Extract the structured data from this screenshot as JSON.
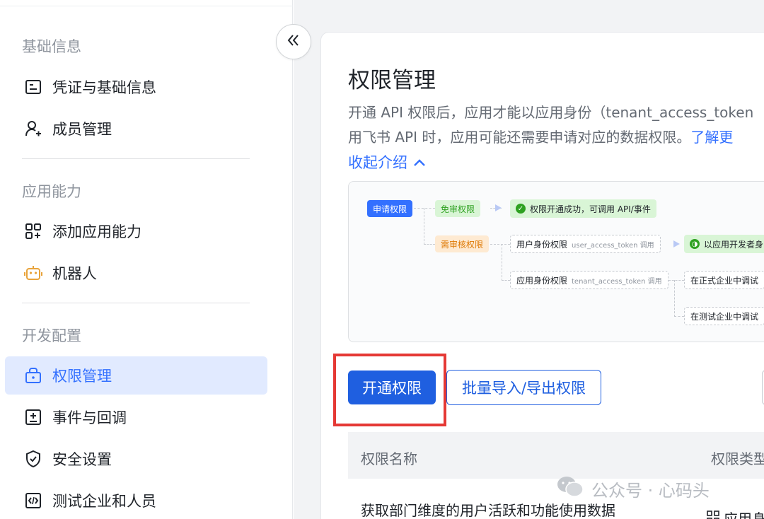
{
  "sidebar": {
    "sections": [
      {
        "title": "基础信息",
        "items": [
          {
            "label": "凭证与基础信息",
            "icon": "credential-icon"
          },
          {
            "label": "成员管理",
            "icon": "add-member-icon"
          }
        ]
      },
      {
        "title": "应用能力",
        "items": [
          {
            "label": "添加应用能力",
            "icon": "add-capability-icon"
          },
          {
            "label": "机器人",
            "icon": "robot-icon"
          }
        ]
      },
      {
        "title": "开发配置",
        "items": [
          {
            "label": "权限管理",
            "icon": "permission-icon",
            "active": true
          },
          {
            "label": "事件与回调",
            "icon": "event-icon"
          },
          {
            "label": "安全设置",
            "icon": "shield-icon"
          },
          {
            "label": "测试企业和人员",
            "icon": "code-icon"
          }
        ]
      }
    ]
  },
  "main": {
    "title": "权限管理",
    "desc_line1": "开通 API 权限后，应用才能以应用身份（tenant_access_token",
    "desc_line2": "用飞书 API 时，应用可能还需要申请对应的数据权限。",
    "desc_link": "了解更",
    "collapse_label": "收起介绍",
    "diagram": {
      "apply": "申请权限",
      "free": "免审权限",
      "success": "权限开通成功，可调用 API/事件",
      "review": "需审核权限",
      "user_perm": "用户身份权限",
      "user_token": "user_access_token 调用",
      "app_dev": "以应用开发者身",
      "app_perm": "应用身份权限",
      "tenant_token": "tenant_access_token 调用",
      "prod_debug": "在正式企业中调试",
      "test_debug": "在测试企业中调试"
    },
    "buttons": {
      "enable": "开通权限",
      "batch": "批量导入/导出权限"
    },
    "table": {
      "col_name": "权限名称",
      "col_type": "权限类型",
      "row1_name": "获取部门维度的用户活跃和功能使用数据",
      "row1_type": "应用身"
    }
  },
  "watermark": "公众号 · 心码头",
  "colors": {
    "accent": "#3370ff",
    "primary_button": "#1f5fe0",
    "highlight": "#e53935"
  }
}
